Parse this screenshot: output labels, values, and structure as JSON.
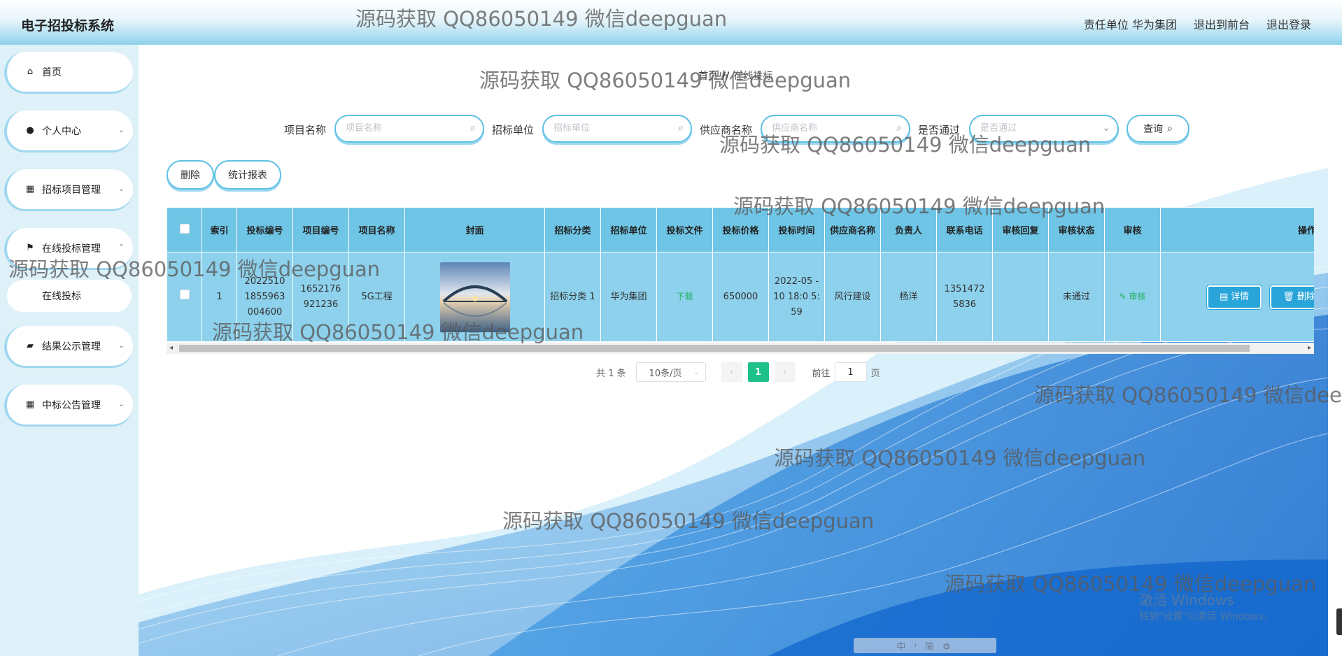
{
  "header": {
    "app_title": "电子招投标系统",
    "links": [
      "责任单位 华为集团",
      "退出到前台",
      "退出登录"
    ]
  },
  "sidebar": {
    "items": [
      {
        "label": "首页",
        "icon": "home-icon",
        "has_arrow": false
      },
      {
        "label": "个人中心",
        "icon": "user-icon",
        "has_arrow": true
      },
      {
        "label": "招标项目管理",
        "icon": "grid-icon",
        "has_arrow": true
      },
      {
        "label": "在线投标管理",
        "icon": "flag-icon",
        "has_arrow": true,
        "expanded": true
      },
      {
        "label": "结果公示管理",
        "icon": "briefcase-icon",
        "has_arrow": true
      },
      {
        "label": "中标公告管理",
        "icon": "grid-icon",
        "has_arrow": true
      }
    ],
    "submenu": [
      "在线投标"
    ]
  },
  "breadcrumb": {
    "home": "首页",
    "separator": "//",
    "current": "在线投标"
  },
  "search": {
    "fields": [
      {
        "label": "项目名称",
        "placeholder": "项目名称"
      },
      {
        "label": "招标单位",
        "placeholder": "招标单位"
      },
      {
        "label": "供应商名称",
        "placeholder": "供应商名称"
      },
      {
        "label": "是否通过",
        "placeholder": "是否通过"
      }
    ],
    "query_label": "查询"
  },
  "actions": {
    "delete_label": "删除",
    "report_label": "统计报表"
  },
  "table": {
    "headers": [
      "索引",
      "投标编号",
      "项目编号",
      "项目名称",
      "封面",
      "招标分类",
      "招标单位",
      "投标文件",
      "投标价格",
      "投标时间",
      "供应商名称",
      "负责人",
      "联系电话",
      "审核回复",
      "审核状态",
      "审核",
      "操作"
    ],
    "rows": [
      {
        "index": "1",
        "bid_no": "2022510 1855963 004600",
        "project_no": "1652176 921236",
        "project_name": "5G工程",
        "category": "招标分类 1",
        "unit": "华为集团",
        "file": "下载",
        "price": "650000",
        "time": "2022-05 -10 18:0 5:59",
        "supplier": "风行建设",
        "manager": "杨洋",
        "phone": "1351472 5836",
        "reply": "",
        "status": "未通过",
        "audit": "审核",
        "op_detail": "详情",
        "op_delete": "删除"
      }
    ]
  },
  "pagination": {
    "total": "共 1 条",
    "page_size": "10条/页",
    "current": "1",
    "goto_label": "前往",
    "goto_value": "1",
    "page_suffix": "页"
  },
  "watermark": "源码获取 QQ86050149 微信deepguan",
  "system": {
    "activate_title": "激活 Windows",
    "activate_sub": "转到\"设置\"以激活 Windows。",
    "ime": "中 ⁾ 简 ⚙"
  },
  "colors": {
    "accent": "#29a5d9",
    "header_row": "#6fc5e6",
    "body_row": "#8dd1ec",
    "current_page": "#1ec18a"
  }
}
